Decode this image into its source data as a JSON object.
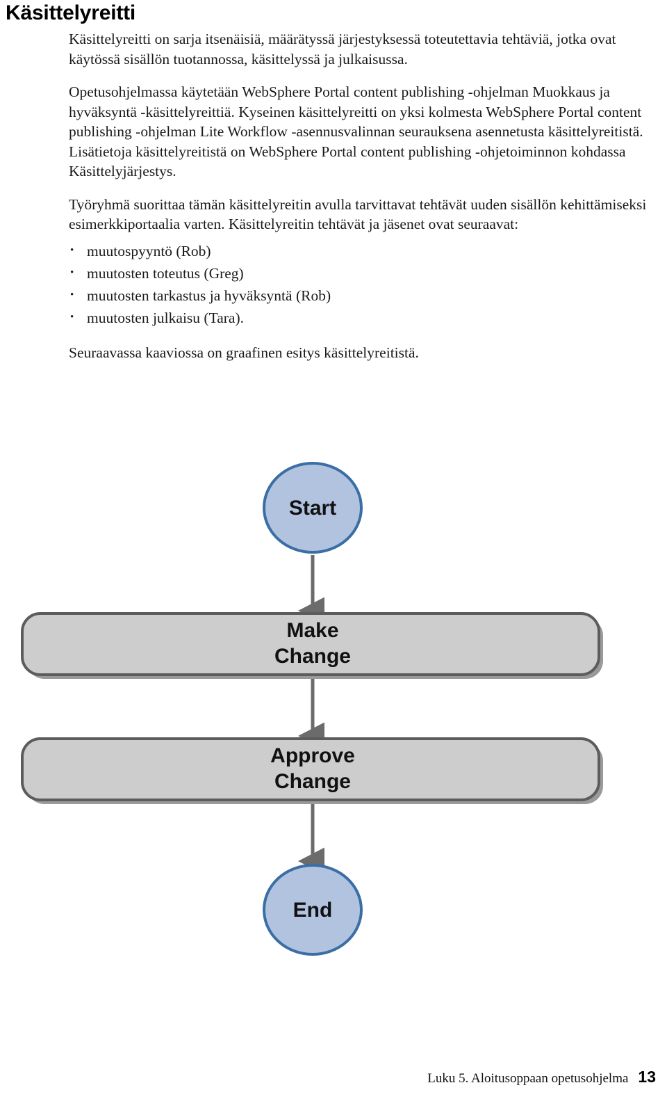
{
  "page": {
    "heading": "Käsittelyreitti",
    "paragraphs": [
      "Käsittelyreitti on sarja itsenäisiä, määrätyssä järjestyksessä toteutettavia tehtäviä, jotka ovat käytössä sisällön tuotannossa, käsittelyssä ja julkaisussa.",
      "Opetusohjelmassa käytetään WebSphere Portal content publishing -ohjelman Muokkaus ja hyväksyntä -käsittelyreittiä. Kyseinen käsittelyreitti on yksi kolmesta WebSphere Portal content publishing -ohjelman Lite Workflow -asennusvalinnan seurauksena asennetusta käsittelyreitistä. Lisätietoja käsittelyreitistä on WebSphere Portal content publishing -ohjetoiminnon kohdassa Käsittelyjärjestys.",
      "Työryhmä suorittaa tämän käsittelyreitin avulla tarvittavat tehtävät uuden sisällön kehittämiseksi esimerkkiportaalia varten. Käsittelyreitin tehtävät ja jäsenet ovat seuraavat:"
    ],
    "bullets": [
      "muutospyyntö (Rob)",
      "muutosten toteutus (Greg)",
      "muutosten tarkastus ja hyväksyntä (Rob)",
      "muutosten julkaisu (Tara)."
    ],
    "closing_paragraph": "Seuraavassa kaaviossa on graafinen esitys käsittelyreitistä."
  },
  "flowchart": {
    "nodes": [
      {
        "id": "start",
        "label": "Start",
        "shape": "ellipse"
      },
      {
        "id": "make",
        "label_line1": "Make",
        "label_line2": "Change",
        "shape": "rounded-rect"
      },
      {
        "id": "approve",
        "label_line1": "Approve",
        "label_line2": "Change",
        "shape": "rounded-rect"
      },
      {
        "id": "end",
        "label": "End",
        "shape": "ellipse"
      }
    ],
    "edges": [
      {
        "from": "start",
        "to": "make"
      },
      {
        "from": "make",
        "to": "approve"
      },
      {
        "from": "approve",
        "to": "end"
      }
    ],
    "colors": {
      "ellipse_fill": "#b2c3e0",
      "ellipse_stroke": "#3a6ea5",
      "rect_fill": "#cdcdcd",
      "rect_stroke": "#5c5c5c",
      "rect_shadow": "#9a9a9a",
      "arrow": "#6b6b6b",
      "label_text": "#111111"
    }
  },
  "footer": {
    "chapter": "Luku 5. Aloitusoppaan opetusohjelma",
    "page_number": "13"
  }
}
